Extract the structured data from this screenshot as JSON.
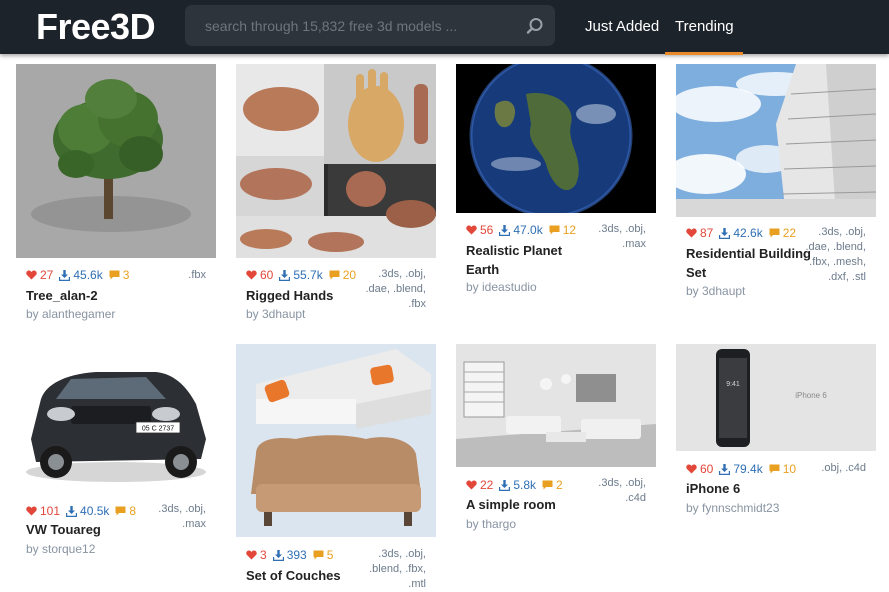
{
  "header": {
    "logo": "Free3D",
    "search_placeholder": "search through 15,832 free 3d models ...",
    "nav": [
      "Just Added",
      "Trending"
    ],
    "active_nav": "Trending"
  },
  "colors": {
    "topbar": "#1d232b",
    "accent": "#e98b2a",
    "likes": "#e2473a",
    "downloads": "#2f6fb4",
    "comments": "#e9a021"
  },
  "models": [
    {
      "title": "Tree_alan-2",
      "author": "by alanthegamer",
      "likes": "27",
      "downloads": "45.6k",
      "comments": "3",
      "formats": ".fbx"
    },
    {
      "title": "Rigged Hands",
      "author": "by 3dhaupt",
      "likes": "60",
      "downloads": "55.7k",
      "comments": "20",
      "formats": ".3ds, .obj, .dae, .blend, .fbx"
    },
    {
      "title": "Realistic Planet Earth",
      "author": "by ideastudio",
      "likes": "56",
      "downloads": "47.0k",
      "comments": "12",
      "formats": ".3ds, .obj, .max"
    },
    {
      "title": "Residential Building Set",
      "author": "by 3dhaupt",
      "likes": "87",
      "downloads": "42.6k",
      "comments": "22",
      "formats": ".3ds, .obj, .dae, .blend, .fbx, .mesh, .dxf, .stl"
    },
    {
      "title": "VW Touareg",
      "author": "by storque12",
      "likes": "101",
      "downloads": "40.5k",
      "comments": "8",
      "formats": ".3ds, .obj, .max"
    },
    {
      "title": "Set of Couches",
      "author": "",
      "likes": "3",
      "downloads": "393",
      "comments": "5",
      "formats": ".3ds, .obj, .blend, .fbx, .mtl"
    },
    {
      "title": "A simple room",
      "author": "by thargo",
      "likes": "22",
      "downloads": "5.8k",
      "comments": "2",
      "formats": ".3ds, .obj, .c4d"
    },
    {
      "title": "iPhone 6",
      "author": "by fynnschmidt23",
      "likes": "60",
      "downloads": "79.4k",
      "comments": "10",
      "formats": ".obj, .c4d"
    }
  ],
  "thumb_text": {
    "iphone_label": "iPhone 6",
    "plate": "05 C 2737",
    "time": "9:41"
  },
  "icons": [
    "search-icon",
    "heart-icon",
    "download-icon",
    "comment-icon"
  ]
}
